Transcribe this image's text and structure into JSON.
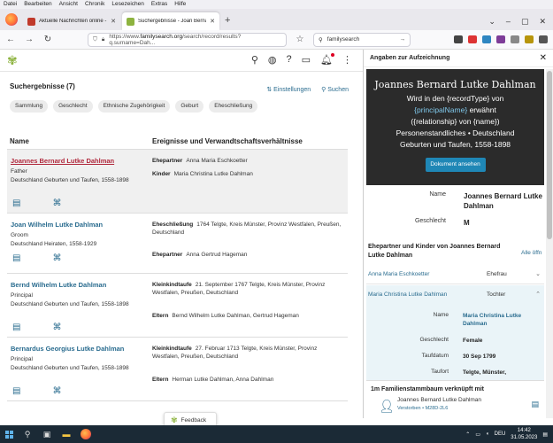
{
  "menu": [
    "Datei",
    "Bearbeiten",
    "Ansicht",
    "Chronik",
    "Lesezeichen",
    "Extras",
    "Hilfe"
  ],
  "tabs": [
    {
      "title": "Aktuelle Nachrichten online - 1",
      "color": "#c0392b"
    },
    {
      "title": "Suchergebnisse - Joan Bernard",
      "color": "#8db33f"
    }
  ],
  "url": {
    "prefix": "https://www.",
    "host": "familysearch.org",
    "path": "/search/record/results?q.surname=Dah..."
  },
  "search_box": "familysearch",
  "results": {
    "title": "Suchergebnisse (7)",
    "settings_label": "Einstellungen",
    "search_label": "Suchen",
    "chips": [
      "Sammlung",
      "Geschlecht",
      "Ethnische Zugehörigkeit",
      "Geburt",
      "Eheschließung"
    ],
    "col_name": "Name",
    "col_events": "Ereignisse und Verwandtschaftsverhältnisse",
    "rows": [
      {
        "name": "Joannes Bernard Lutke Dahlman",
        "role": "Father",
        "collection": "Deutschland Geburten und Taufen, 1558-1898",
        "events": [
          {
            "label": "Ehepartner",
            "text": "Anna Maria Eschkoetter"
          },
          {
            "label": "Kinder",
            "text": "Maria Christina Lutke Dahlman"
          }
        ]
      },
      {
        "name": "Joan Wilhelm Lutke Dahlman",
        "role": "Groom",
        "collection": "Deutschland Heiraten, 1558-1929",
        "events": [
          {
            "label": "Eheschließung",
            "text": "1764 Telgte, Kreis Münster, Provinz Westfalen, Preußen, Deutschland"
          },
          {
            "label": "Ehepartner",
            "text": "Anna Gertrud Hageman"
          }
        ]
      },
      {
        "name": "Bernd Wilhelm Lutke Dahlman",
        "role": "Principal",
        "collection": "Deutschland Geburten und Taufen, 1558-1898",
        "events": [
          {
            "label": "Kleinkindtaufe",
            "text": "21. September 1767 Telgte, Kreis Münster, Provinz Westfalen, Preußen, Deutschland"
          },
          {
            "label": "Eltern",
            "text": "Bernd Wilhelm Lutke Dahlman, Gertrud Hageman"
          }
        ]
      },
      {
        "name": "Bernardus Georgius Lutke Dahlman",
        "role": "Principal",
        "collection": "Deutschland Geburten und Taufen, 1558-1898",
        "events": [
          {
            "label": "Kleinkindtaufe",
            "text": "27. Februar 1713 Telgte, Kreis Münster, Provinz Westfalen, Preußen, Deutschland"
          },
          {
            "label": "Eltern",
            "text": "Herman Lutke Dahlman, Anna Dahlman"
          }
        ]
      }
    ],
    "feedback": "Feedback"
  },
  "panel": {
    "header": "Angaben zur Aufzeichnung",
    "hero_name": "Joannes Bernard Lutke Dahlman",
    "hero_line1": "Wird in den {recordType} von",
    "hero_line2": "{principalName}",
    "hero_line2b": "erwähnt",
    "hero_line3": "({relationship} von {name})",
    "hero_line4": "Personenstandliches • Deutschland",
    "hero_line5": "Geburten und Taufen, 1558-1898",
    "hero_button": "Dokument ansehen",
    "name_label": "Name",
    "name_value": "Joannes Bernard Lutke Dahlman",
    "gender_label": "Geschlecht",
    "gender_value": "M",
    "family_title": "Ehepartner und Kinder von Joannes Bernard Lutke Dahlman",
    "all_link": "Alle öffn",
    "relations": [
      {
        "name": "Anna Maria Eschkoetter",
        "type": "Ehefrau"
      },
      {
        "name": "Maria Christina Lutke Dahlman",
        "type": "Tochter"
      }
    ],
    "child": {
      "name_label": "Name",
      "name_value": "Maria Christina Lutke Dahlman",
      "sex_label": "Geschlecht",
      "sex_value": "Female",
      "baptism_label": "Taufdatum",
      "baptism_value": "30 Sep 1799",
      "place_label": "Taufort",
      "place_value": "Telgte, Münster,"
    },
    "tree_title": "1m Familienstammbaum verknüpft mit",
    "tree_name": "Joannes Bernard Lutke Dahlman",
    "tree_meta": "Verstorben • M28D-2L6"
  },
  "taskbar": {
    "time": "14:42",
    "date": "31.05.2023",
    "tray": "DEU"
  }
}
